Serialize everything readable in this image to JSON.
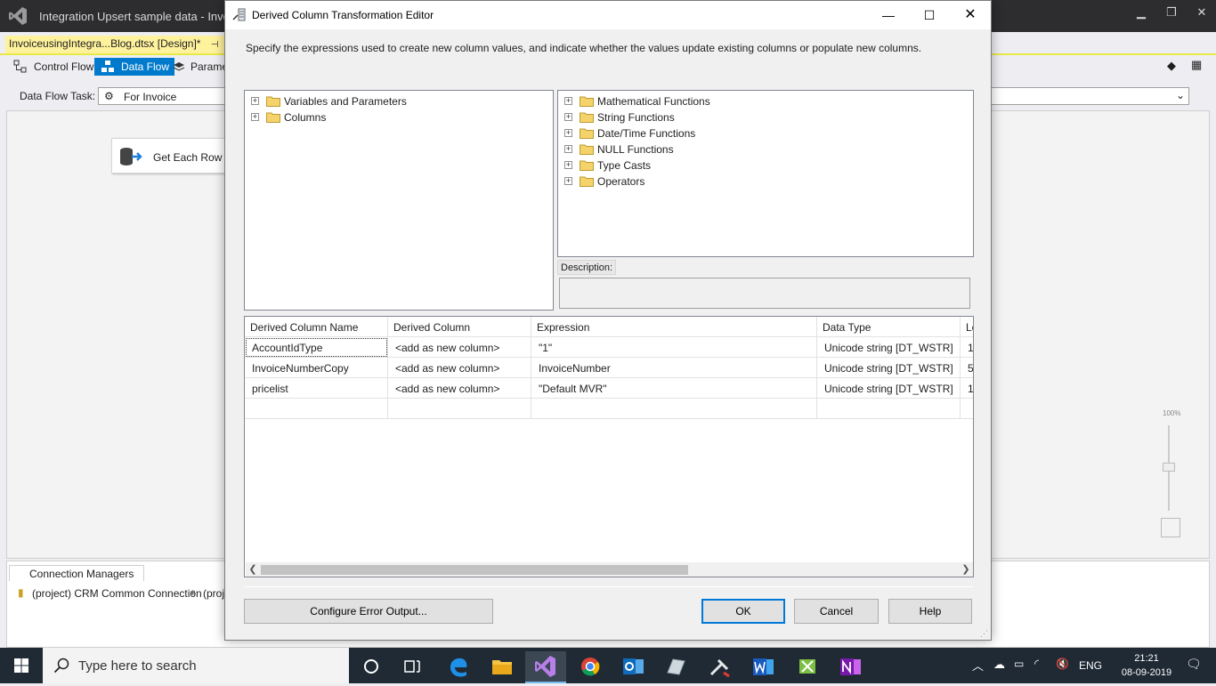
{
  "vs": {
    "title": "Integration Upsert sample data - Invoic",
    "doc_tab": "InvoiceusingIntegra...Blog.dtsx [Design]*",
    "doc_tab_pin": "⊕",
    "tabs": [
      {
        "label": "Control Flow"
      },
      {
        "label": "Data Flow"
      },
      {
        "label": "Paramet"
      }
    ],
    "task_label": "Data Flow Task:",
    "task_value": "For Invoice",
    "component_label": "Get Each Row of",
    "zoom_label": "100%",
    "conn_tab": "Connection Managers",
    "connections": [
      "(project) CRM Common Connection",
      "(proj"
    ]
  },
  "dialog": {
    "title": "Derived Column Transformation Editor",
    "instructions": "Specify the expressions used to create new column values, and indicate whether the values update existing columns or populate new columns.",
    "left_tree": [
      "Variables and Parameters",
      "Columns"
    ],
    "right_tree": [
      "Mathematical Functions",
      "String Functions",
      "Date/Time Functions",
      "NULL Functions",
      "Type Casts",
      "Operators"
    ],
    "description_label": "Description:",
    "grid": {
      "headers": [
        "Derived Column Name",
        "Derived Column",
        "Expression",
        "Data Type",
        "Le"
      ],
      "rows": [
        [
          "AccountIdType",
          "<add as new column>",
          "\"1\"",
          "Unicode string [DT_WSTR]",
          "1"
        ],
        [
          "InvoiceNumberCopy",
          "<add as new column>",
          "InvoiceNumber",
          "Unicode string [DT_WSTR]",
          "5"
        ],
        [
          "pricelist",
          "<add as new column>",
          "\"Default MVR\"",
          "Unicode string [DT_WSTR]",
          "1"
        ]
      ]
    },
    "buttons": {
      "configure": "Configure Error Output...",
      "ok": "OK",
      "cancel": "Cancel",
      "help": "Help"
    }
  },
  "taskbar": {
    "search_placeholder": "Type here to search",
    "language": "ENG",
    "time": "21:21",
    "date": "08-09-2019"
  },
  "colors": {
    "accent": "#007acc",
    "taskbar": "#1f2a35",
    "doc_tab": "#fff29d"
  }
}
